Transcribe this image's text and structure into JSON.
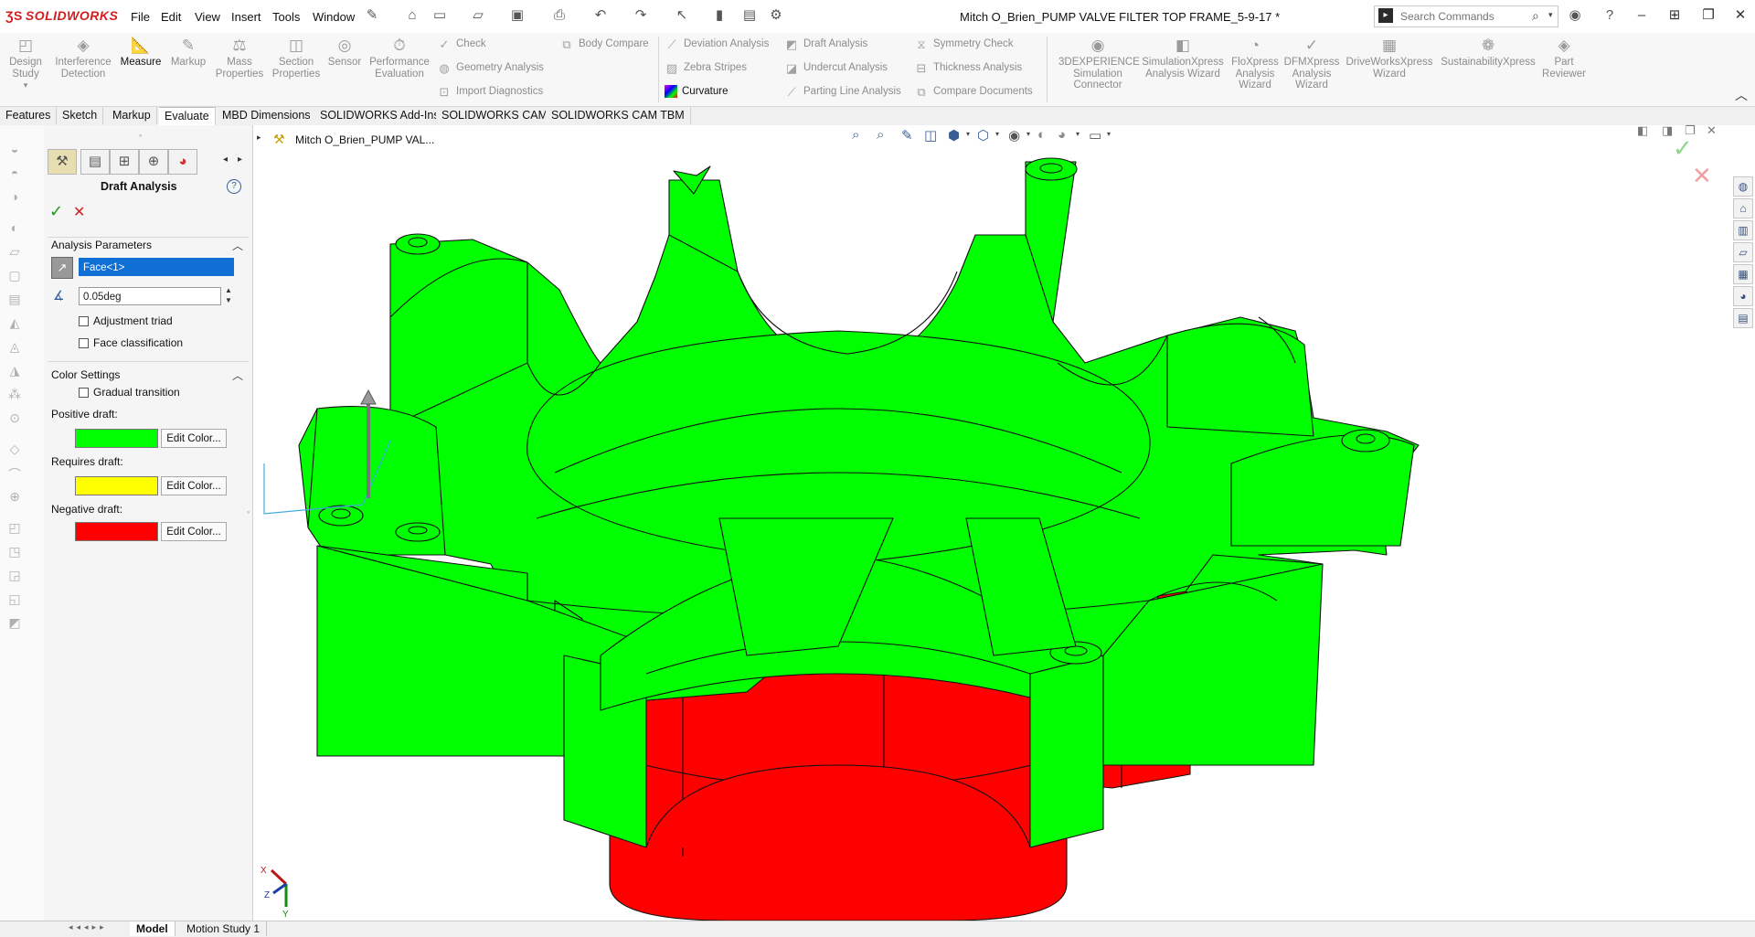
{
  "app": {
    "logo_text": "SOLIDWORKS",
    "title": "Mitch O_Brien_PUMP VALVE FILTER TOP FRAME_5-9-17 *",
    "menus": [
      "File",
      "Edit",
      "View",
      "Insert",
      "Tools",
      "Window"
    ],
    "search_placeholder": "Search Commands"
  },
  "ribbon": {
    "big": [
      {
        "label": "Design Study"
      },
      {
        "label": "Interference Detection"
      },
      {
        "label": "Measure"
      },
      {
        "label": "Markup"
      },
      {
        "label": "Mass Properties"
      },
      {
        "label": "Section Properties"
      },
      {
        "label": "Sensor"
      },
      {
        "label": "Performance Evaluation"
      }
    ],
    "small_col1": [
      "Check",
      "Geometry Analysis",
      "Import Diagnostics"
    ],
    "small_col2": [
      "Body Compare"
    ],
    "small_col3": [
      "Deviation Analysis",
      "Zebra Stripes",
      "Curvature"
    ],
    "small_col4": [
      "Draft Analysis",
      "Undercut Analysis",
      "Parting Line Analysis"
    ],
    "small_col5": [
      "Symmetry Check",
      "Thickness Analysis",
      "Compare Documents"
    ],
    "big_right": [
      {
        "label": "3DEXPERIENCE Simulation Connector"
      },
      {
        "label": "SimulationXpress Analysis Wizard"
      },
      {
        "label": "FloXpress Analysis Wizard"
      },
      {
        "label": "DFMXpress Analysis Wizard"
      },
      {
        "label": "DriveWorksXpress Wizard"
      },
      {
        "label": "SustainabilityXpress"
      },
      {
        "label": "Part Reviewer"
      }
    ]
  },
  "tabs": [
    "Features",
    "Sketch",
    "Markup",
    "Evaluate",
    "MBD Dimensions",
    "SOLIDWORKS Add-Ins",
    "SOLIDWORKS CAM",
    "SOLIDWORKS CAM TBM"
  ],
  "pm": {
    "title": "Draft Analysis",
    "analysis_params": "Analysis Parameters",
    "face_value": "Face<1>",
    "angle_value": "0.05deg",
    "adjustment_triad": "Adjustment triad",
    "face_classification": "Face classification",
    "color_settings": "Color Settings",
    "gradual_transition": "Gradual transition",
    "positive_draft": "Positive draft:",
    "requires_draft": "Requires draft:",
    "negative_draft": "Negative draft:",
    "edit_color": "Edit Color...",
    "colors": {
      "positive": "#00ff00",
      "requires": "#ffff00",
      "negative": "#ff0000"
    }
  },
  "tree": {
    "root": "Mitch O_Brien_PUMP VAL..."
  },
  "bottom_tabs": [
    "Model",
    "Motion Study 1"
  ],
  "triad": {
    "x": "X",
    "y": "Y",
    "z": "Z"
  }
}
